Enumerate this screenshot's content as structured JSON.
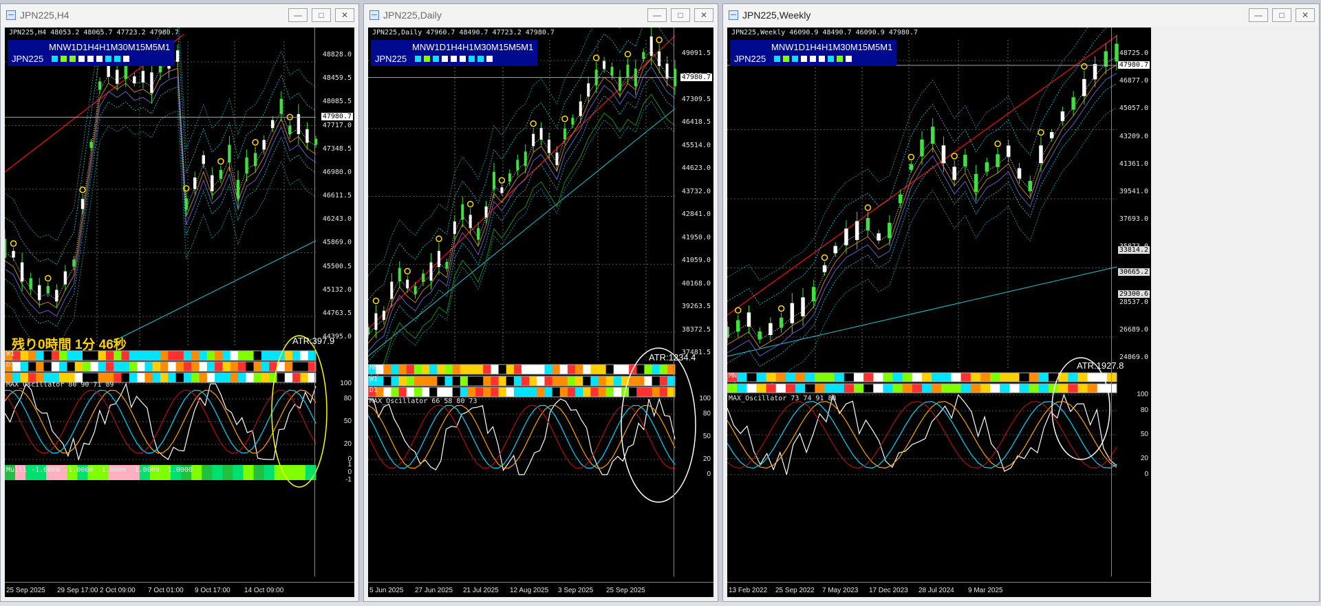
{
  "windows": [
    {
      "title": "JPN225,H4",
      "ohlc": "JPN225,H4  48053.2 48065.7 47723.2 47980.7",
      "symbol": "JPN225",
      "tf_label": "MNW1D1H4H1M30M15M5M1",
      "tf_colors": [
        "#00e5ff",
        "#80ff00",
        "#80ff00",
        "#ffffff",
        "#ffffff",
        "#ffffff",
        "#00e5ff",
        "#00e5ff",
        "#ffffff"
      ],
      "prices": [
        "48828.0",
        "48459.5",
        "48085.5",
        "47717.0",
        "47348.5",
        "46980.0",
        "46611.5",
        "46243.0",
        "45869.0",
        "45500.5",
        "45132.0",
        "44763.5",
        "44395.0"
      ],
      "current_price": "47980.7",
      "dates": [
        "25 Sep 2025",
        "29 Sep 17:00",
        "2 Oct 09:00",
        "7 Oct 01:00",
        "9 Oct 17:00",
        "14 Oct 09:00"
      ],
      "remaining": "残り0時間 1分 46秒",
      "atr": "ATR:397.9",
      "bar_labels": [
        "W1",
        "D1"
      ],
      "osc_label": "MAX_Oscillator 80 90 71 89",
      "osc_ticks": [
        "100",
        "80",
        "50",
        "20",
        "0"
      ],
      "multi_label": "Multi -1.0000 -1.0000 -1.0000 -1.0000 -1.0000",
      "multi_ticks": [
        "1",
        "0",
        "-1"
      ]
    },
    {
      "title": "JPN225,Daily",
      "ohlc": "JPN225,Daily  47960.7 48490.7 47723.2 47980.7",
      "symbol": "JPN225",
      "tf_label": "MNW1D1H4H1M30M15M5M1",
      "tf_colors": [
        "#00e5ff",
        "#80ff00",
        "#00e5ff",
        "#ffffff",
        "#ffffff",
        "#ffffff",
        "#00e5ff",
        "#00e5ff",
        "#ffffff"
      ],
      "prices": [
        "49091.5",
        "48200.5",
        "47309.5",
        "46418.5",
        "45514.0",
        "44623.0",
        "43732.0",
        "42841.0",
        "41950.0",
        "41059.0",
        "40168.0",
        "39263.5",
        "38372.5",
        "37481.5"
      ],
      "current_price": "47980.7",
      "dates": [
        "5 Jun 2025",
        "27 Jun 2025",
        "21 Jul 2025",
        "12 Aug 2025",
        "3 Sep 2025",
        "25 Sep 2025"
      ],
      "atr": "ATR:1234.4",
      "bar_labels": [
        "MN",
        "W1",
        "D1"
      ],
      "osc_label": "MAX_Oscillator 66 58 80 73",
      "osc_ticks": [
        "100",
        "80",
        "50",
        "20",
        "0"
      ]
    },
    {
      "title": "JPN225,Weekly",
      "ohlc": "JPN225,Weekly  46090.9 48490.7 46090.9 47980.7",
      "symbol": "JPN225",
      "tf_label": "MNW1D1H4H1M30M15M5M1",
      "tf_colors": [
        "#00e5ff",
        "#80ff00",
        "#00e5ff",
        "#ffffff",
        "#ffffff",
        "#ffffff",
        "#00e5ff",
        "#80ff00",
        "#ffffff"
      ],
      "prices": [
        "48725.0",
        "46877.0",
        "45057.0",
        "43209.0",
        "41361.0",
        "39541.0",
        "37693.0",
        "35873.0",
        "32205.0",
        "28537.0",
        "26689.0",
        "24869.0"
      ],
      "current_price": "47980.7",
      "marked_prices": [
        "33814.2",
        "30665.2",
        "29300.6"
      ],
      "dates": [
        "13 Feb 2022",
        "25 Sep 2022",
        "7 May 2023",
        "17 Dec 2023",
        "28 Jul 2024",
        "9 Mar 2025"
      ],
      "atr": "ATR:1927.8",
      "bar_labels": [
        "MN"
      ],
      "osc_label": "MAX_Oscillator 73 74 91 88",
      "osc_ticks": [
        "100",
        "80",
        "50",
        "20",
        "0"
      ]
    }
  ]
}
